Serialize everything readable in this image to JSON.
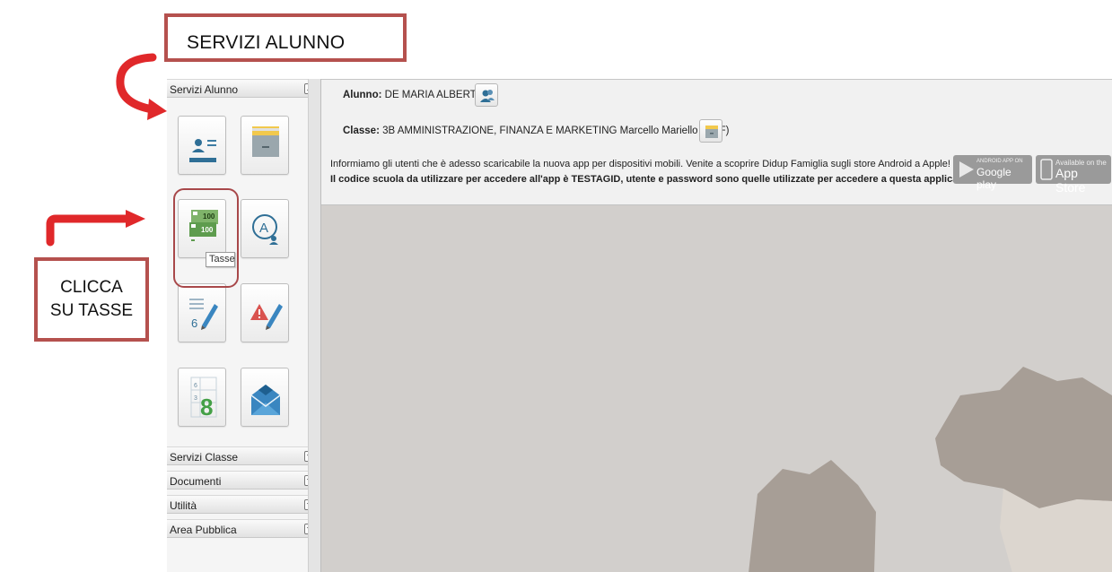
{
  "annotations": {
    "servizi_label": "SERVIZI ALUNNO",
    "tasse_line1": "CLICCA",
    "tasse_line2": "SU TASSE"
  },
  "sidebar": {
    "sections": [
      {
        "label": "Servizi Alunno",
        "expanded": true
      },
      {
        "label": "Servizi Classe",
        "expanded": false
      },
      {
        "label": "Documenti",
        "expanded": false
      },
      {
        "label": "Utilità",
        "expanded": false
      },
      {
        "label": "Area Pubblica",
        "expanded": false
      }
    ],
    "tiles": [
      {
        "icon": "student-card-icon"
      },
      {
        "icon": "archive-icon"
      },
      {
        "icon": "tasse-icon",
        "badge_top": "100",
        "badge_bottom": "100"
      },
      {
        "icon": "absence-icon"
      },
      {
        "icon": "grades-icon",
        "badge": "6"
      },
      {
        "icon": "notes-warning-icon"
      },
      {
        "icon": "register-icon",
        "digit_a": "6",
        "digit_b": "3",
        "digit_c": "8"
      },
      {
        "icon": "mail-icon"
      }
    ],
    "tooltip": "Tasse"
  },
  "main": {
    "student_label": "Alunno:",
    "student_value": "DE MARIA ALBERTO",
    "class_label": "Classe:",
    "class_value": "3B AMMINISTRAZIONE, FINANZA E MARKETING Marcello Mariello (ITAF)",
    "notice_line1": "Informiamo gli utenti che è adesso scaricabile la nuova app per dispositivi mobili. Venite a scoprire Didup Famiglia sugli store Android a Apple!",
    "notice_line2": "Il codice scuola da utilizzare per accedere all'app è TESTAGID, utente e password sono quelle utilizzate per accedere a questa applicazione.",
    "google_small": "ANDROID APP ON",
    "google_big": "Google play",
    "apple_small": "Available on the",
    "apple_big": "App Store"
  },
  "colors": {
    "annotation": "#b5514e",
    "background_shape_dark": "#a79e96",
    "background_shape_light": "#dcd6cf"
  }
}
